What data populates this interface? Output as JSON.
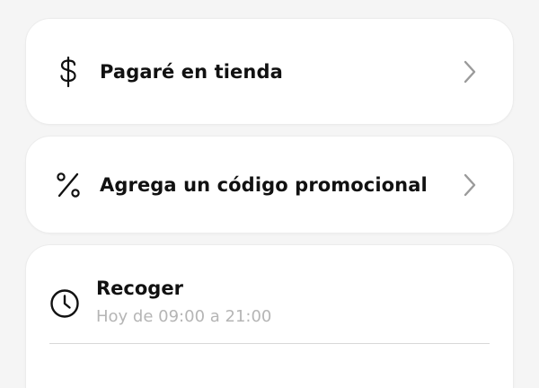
{
  "payment": {
    "label": "Pagaré en tienda",
    "icon": "dollar-icon"
  },
  "promo": {
    "label": "Agrega un código promocional",
    "icon": "percent-icon"
  },
  "pickup": {
    "title": "Recoger",
    "hours": "Hoy de 09:00 a 21:00",
    "icon": "clock-icon"
  },
  "colors": {
    "background": "#f5f5f5",
    "card": "#ffffff",
    "text": "#111111",
    "muted": "#b5b5b5",
    "chevron": "#9a9a9a"
  }
}
